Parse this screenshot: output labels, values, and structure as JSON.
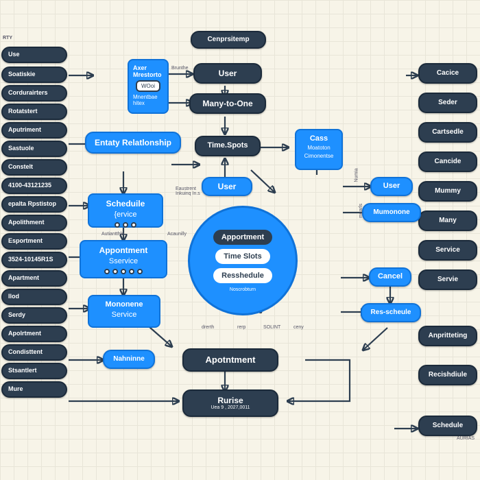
{
  "header": {
    "title": "Cenprsitemp"
  },
  "topLabel": "RTY",
  "leftColumn": [
    "Use",
    "Soatiskie",
    "Cordurairters",
    "Rotatstert",
    "Aputriment",
    "Sastuole",
    "Constelt",
    "4100-43121235",
    "epalta Rpstistop",
    "Apolithment",
    "Esportment",
    "3524-10145R1S",
    "Apartment",
    "Ilod",
    "Serdy",
    "Apolrtment",
    "Condisttent",
    "Stsantlert",
    "Mure"
  ],
  "rightColumn": [
    "Cacice",
    "Seder",
    "Cartsedle",
    "Cancide",
    "Mummy",
    "Many",
    "Service",
    "Servie",
    "Anpritteting",
    "Recishdiule",
    "Schedule"
  ],
  "topRow": {
    "user": "User",
    "manyToOne": "Many-to-One"
  },
  "panels": {
    "userMgmt": {
      "title": "Axer Mrestorto",
      "sub": "WOoi",
      "foot": "Mnentbae hitex"
    },
    "entityRel": "Entaty Relatlonship",
    "scheduleService": {
      "title": "Scheduile",
      "sub": "{ervice"
    },
    "appointmentService": {
      "title": "Appontment",
      "sub": "Sservice"
    },
    "monoeneService": {
      "title": "Mononene",
      "sub": "Service"
    },
    "nahnione": "Nahninne"
  },
  "midNodes": {
    "timeSpots": "Time.Spots",
    "user2": "User",
    "appointment2": "Apotntment",
    "rurise": "Rurise",
    "ruriseSub": "Uea 9 , 2027,0011"
  },
  "case": {
    "title": "Cass",
    "sub1": "Moatoton",
    "sub2": "Cimonentse"
  },
  "sideRight": {
    "user": "User",
    "mumonone": "Mumonone",
    "cancel": "Cancel",
    "reschedule": "Res-scheule"
  },
  "circle": {
    "appointment": "Apportment",
    "timeslots": "Time Slots",
    "reschedule": "Resshedule",
    "foot": "Noscrobturn"
  },
  "micro": {
    "brintle": "Brunthe",
    "eaustrent": "Eaustrent Inkuinq In.s",
    "autanthle": "Autiantthle",
    "acaunilty": "Acaunilly",
    "numia": "Numia",
    "muarls": "muarls",
    "drerth": "drerth",
    "solint": "SOLINT",
    "rerp": "rerp",
    "ceny": "ceny",
    "aurias": "AURIAS"
  }
}
